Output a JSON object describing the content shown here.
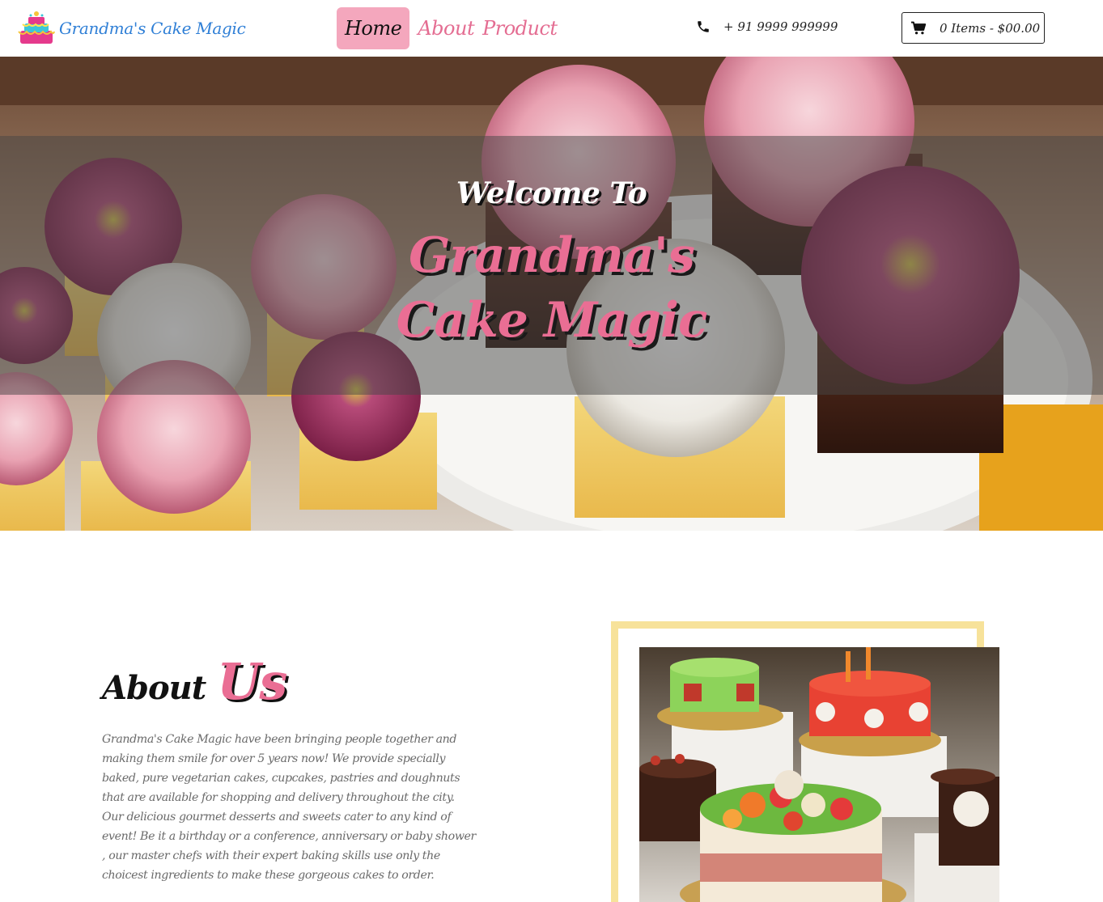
{
  "brand": {
    "name": "Grandma's Cake Magic",
    "logo_icon": "cake-logo-icon"
  },
  "nav": {
    "items": [
      {
        "label": "Home",
        "active": true
      },
      {
        "label": "About",
        "active": false
      },
      {
        "label": "Product",
        "active": false
      }
    ]
  },
  "contact": {
    "phone": "+ 91 9999 999999",
    "icon": "phone-icon"
  },
  "cart": {
    "summary": "0 Items - $00.00",
    "icon": "cart-icon"
  },
  "hero": {
    "welcome": "Welcome To",
    "title_line1": "Grandma's",
    "title_line2": "Cake Magic"
  },
  "about": {
    "heading_part1": "About",
    "heading_part2": "Us",
    "body": "Grandma's Cake Magic have been bringing people together and making them smile for over 5 years now! We provide specially baked, pure vegetarian cakes, cupcakes, pastries and doughnuts that are available for shopping and delivery throughout the city. Our delicious gourmet desserts and sweets cater to any kind of event! Be it a birthday or a conference, anniversary or baby shower , our master chefs with their expert baking skills use only the choicest ingredients to make these gorgeous cakes to order."
  },
  "colors": {
    "accent_pink": "#ea6e94",
    "nav_active_bg": "#f4a7bd",
    "brand_blue": "#2f7fd6",
    "frame_yellow": "#f7e29a"
  }
}
